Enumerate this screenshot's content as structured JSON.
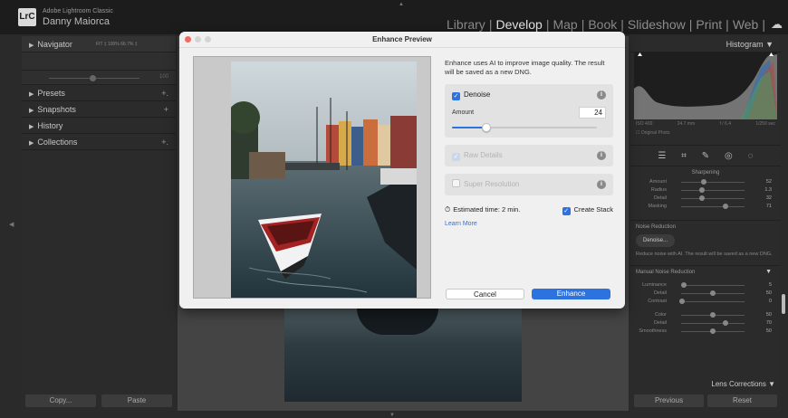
{
  "app": {
    "logo": "LrC",
    "name": "Adobe Lightroom Classic",
    "user": "Danny Maiorca"
  },
  "modules": [
    "Library",
    "Develop",
    "Map",
    "Book",
    "Slideshow",
    "Print",
    "Web"
  ],
  "active_module": "Develop",
  "left_panel": {
    "navigator": "Navigator",
    "navigator_options": "FIT ‡  100%  66.7% ‡",
    "preset_amount_value": "100",
    "presets": "Presets",
    "snapshots": "Snapshots",
    "history": "History",
    "collections": "Collections",
    "copy_label": "Copy...",
    "paste_label": "Paste"
  },
  "dialog": {
    "title": "Enhance Preview",
    "description": "Enhance uses AI to improve image quality. The result will be saved as a new DNG.",
    "denoise_label": "Denoise",
    "denoise_checked": true,
    "amount_label": "Amount",
    "amount_value": "24",
    "amount_fraction": 0.24,
    "raw_details_label": "Raw Details",
    "super_resolution_label": "Super Resolution",
    "estimated_time": "Estimated time: 2 min.",
    "create_stack_label": "Create Stack",
    "learn_more": "Learn More",
    "cancel_label": "Cancel",
    "enhance_label": "Enhance"
  },
  "right_panel": {
    "histogram_label": "Histogram",
    "iso": "ISO 400",
    "focal": "24.7 mm",
    "aperture": "f / 6.4",
    "shutter": "1/250 sec",
    "original_photo": "Original Photo",
    "sharpening_title": "Sharpening",
    "sharpening": [
      {
        "label": "Amount",
        "value": "52"
      },
      {
        "label": "Radius",
        "value": "1.3"
      },
      {
        "label": "Detail",
        "value": "32"
      },
      {
        "label": "Masking",
        "value": "71"
      }
    ],
    "noise_reduction_title": "Noise Reduction",
    "denoise_button": "Denoise...",
    "noise_reduction_desc": "Reduce noise with AI. The result will be saved as a new DNG.",
    "manual_nr_title": "Manual Noise Reduction",
    "manual_nr": [
      {
        "label": "Luminance",
        "value": "5"
      },
      {
        "label": "Detail",
        "value": "50"
      },
      {
        "label": "Contrast",
        "value": "0"
      }
    ],
    "color_nr": [
      {
        "label": "Color",
        "value": "50"
      },
      {
        "label": "Detail",
        "value": "70"
      },
      {
        "label": "Smoothness",
        "value": "50"
      }
    ],
    "lens_corrections": "Lens Corrections",
    "previous_label": "Previous",
    "reset_label": "Reset"
  },
  "colors": {
    "accent": "#2c73e0",
    "close_button": "#ed6a5e"
  }
}
